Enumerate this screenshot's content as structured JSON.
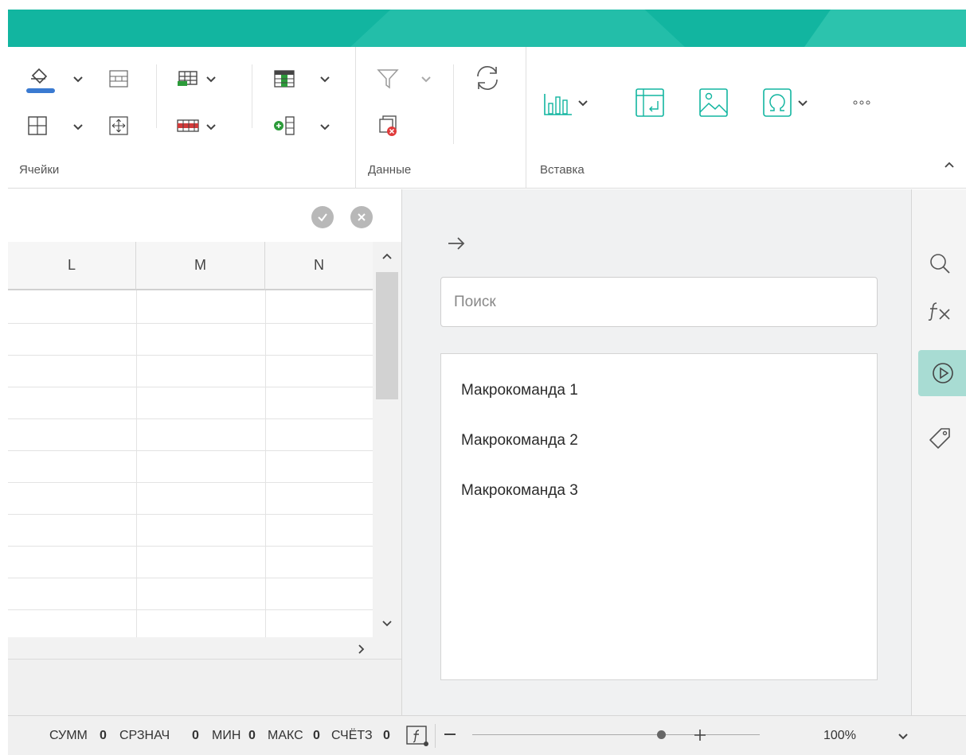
{
  "ribbon": {
    "groups": {
      "cells_label": "Ячейки",
      "data_label": "Данные",
      "insert_label": "Вставка"
    }
  },
  "grid": {
    "columns": [
      "L",
      "M",
      "N"
    ]
  },
  "panel": {
    "search_placeholder": "Поиск",
    "macros": [
      "Макрокоманда 1",
      "Макрокоманда 2",
      "Макрокоманда 3"
    ]
  },
  "status": {
    "sum_label": "СУММ",
    "sum_value": "0",
    "avg_label": "СРЗНАЧ",
    "avg_value": "0",
    "min_label": "МИН",
    "min_value": "0",
    "max_label": "МАКС",
    "max_value": "0",
    "count_label": "СЧЁТЗ",
    "count_value": "0",
    "zoom": "100%"
  },
  "colors": {
    "accent": "#12b5a0",
    "active_side": "#a8dcd3"
  },
  "icons": {
    "sidebar": [
      "search-icon",
      "function-icon",
      "macro-play-icon",
      "tag-icon"
    ]
  }
}
